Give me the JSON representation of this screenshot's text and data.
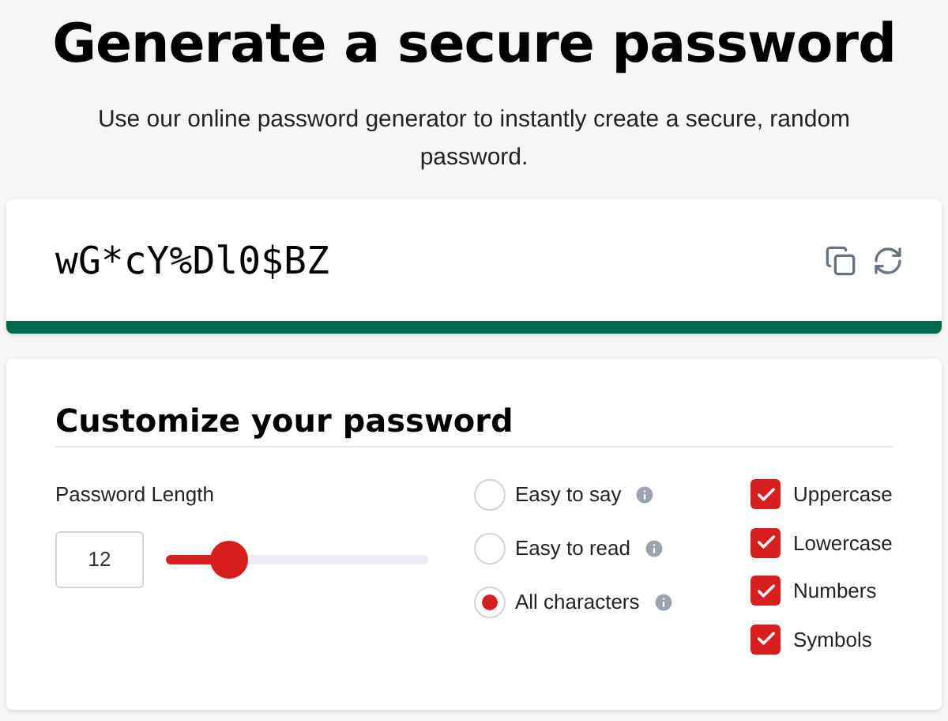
{
  "title": "Generate a secure password",
  "subtitle": "Use our online password generator to instantly create a secure, random password.",
  "password": {
    "value": "wG*cY%Dl0$BZ",
    "strength": {
      "level": 1,
      "color": "#006b4a"
    }
  },
  "customize": {
    "heading": "Customize your password",
    "length": {
      "label": "Password Length",
      "value": "12",
      "level": 0.24
    },
    "modes": [
      {
        "label": "Easy to say",
        "selected": false
      },
      {
        "label": "Easy to read",
        "selected": false
      },
      {
        "label": "All characters",
        "selected": true
      }
    ],
    "options": [
      {
        "label": "Uppercase",
        "checked": true
      },
      {
        "label": "Lowercase",
        "checked": true
      },
      {
        "label": "Numbers",
        "checked": true
      },
      {
        "label": "Symbols",
        "checked": true
      }
    ]
  }
}
